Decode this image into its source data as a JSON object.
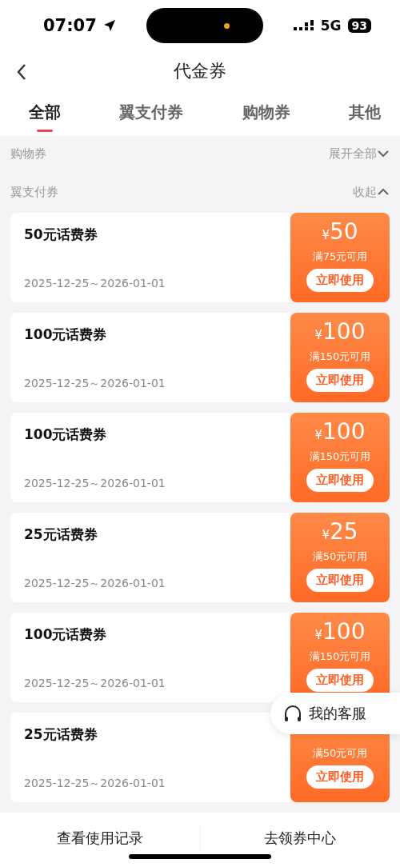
{
  "status_bar": {
    "time": "07:07",
    "network": "5G",
    "battery": "93"
  },
  "header": {
    "title": "代金券"
  },
  "tabs": [
    {
      "label": "全部",
      "selected": true
    },
    {
      "label": "翼支付券",
      "selected": false
    },
    {
      "label": "购物券",
      "selected": false
    },
    {
      "label": "其他",
      "selected": false
    }
  ],
  "sections": [
    {
      "title": "购物券",
      "toggle": "展开全部",
      "expanded": false
    },
    {
      "title": "翼支付券",
      "toggle": "收起",
      "expanded": true
    }
  ],
  "coupons": [
    {
      "name": "50元话费券",
      "validity": "2025-12-25～2026-01-01",
      "currency": "¥",
      "amount": "50",
      "condition": "满75元可用",
      "action": "立即使用"
    },
    {
      "name": "100元话费券",
      "validity": "2025-12-25～2026-01-01",
      "currency": "¥",
      "amount": "100",
      "condition": "满150元可用",
      "action": "立即使用"
    },
    {
      "name": "100元话费券",
      "validity": "2025-12-25～2026-01-01",
      "currency": "¥",
      "amount": "100",
      "condition": "满150元可用",
      "action": "立即使用"
    },
    {
      "name": "25元话费券",
      "validity": "2025-12-25～2026-01-01",
      "currency": "¥",
      "amount": "25",
      "condition": "满50元可用",
      "action": "立即使用"
    },
    {
      "name": "100元话费券",
      "validity": "2025-12-25～2026-01-01",
      "currency": "¥",
      "amount": "100",
      "condition": "满150元可用",
      "action": "立即使用"
    },
    {
      "name": "25元话费券",
      "validity": "2025-12-25～2026-01-01",
      "condition": "满50元可用",
      "action": "立即使用"
    }
  ],
  "floating_button": {
    "label": "我的客服"
  },
  "bottom_bar": [
    "查看使用记录",
    "去领券中心"
  ]
}
